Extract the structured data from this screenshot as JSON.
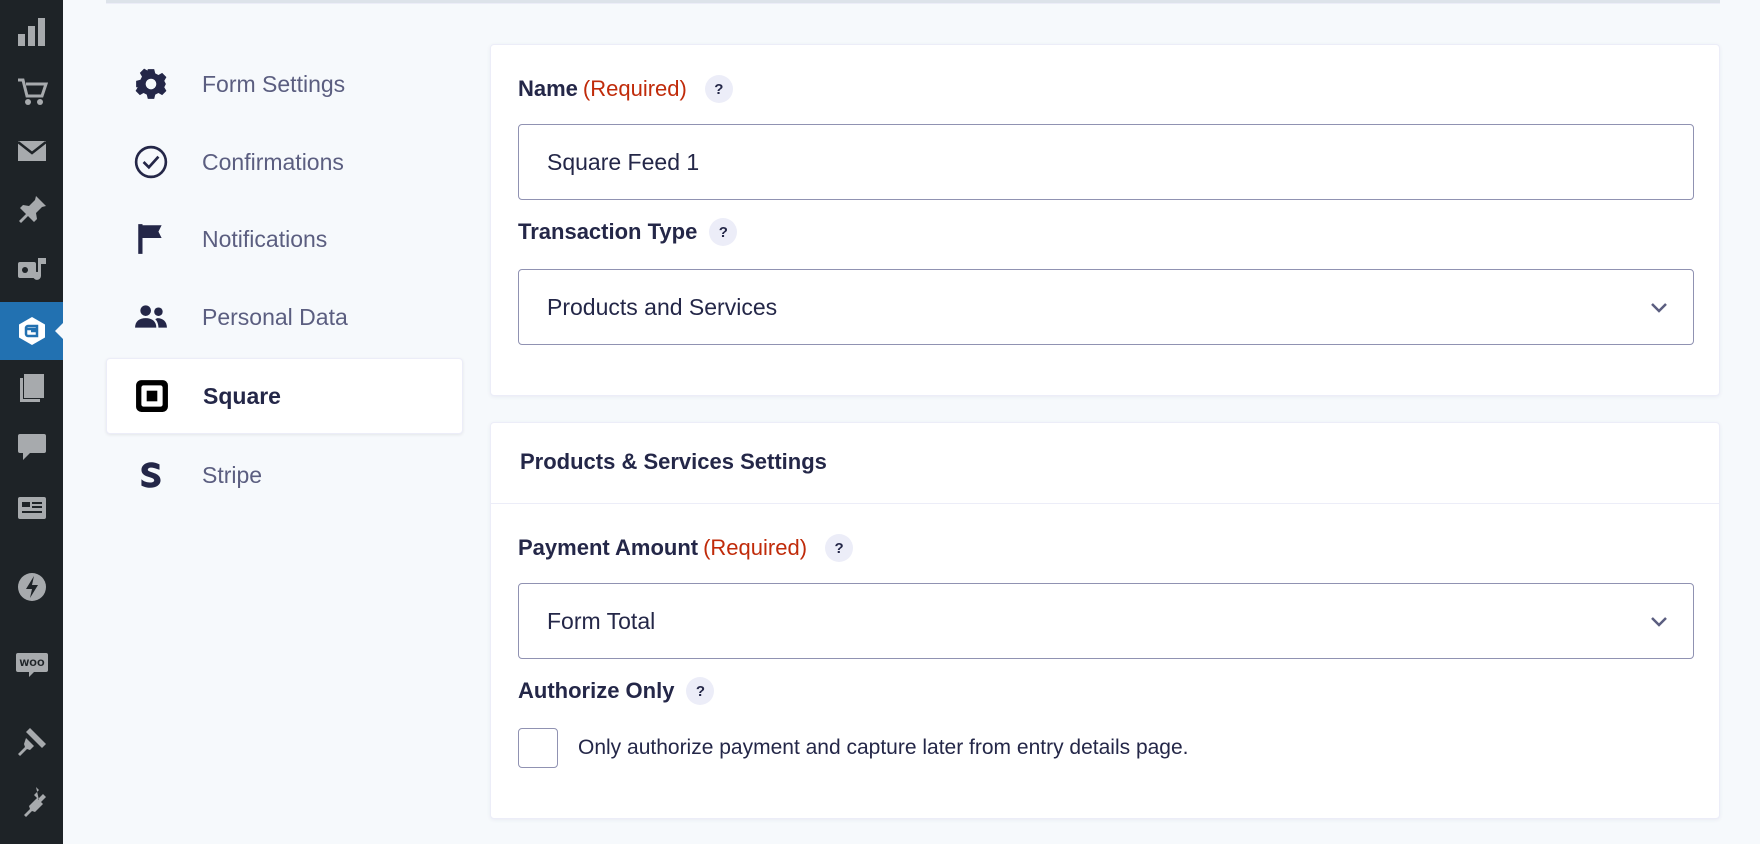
{
  "admin_sidebar": {
    "icons": [
      "dashboard-chart-icon",
      "cart-icon",
      "mail-icon",
      "pin-icon",
      "media-icon",
      "gravity-forms-icon",
      "pages-icon",
      "comments-icon",
      "forms-list-icon",
      "bolt-icon",
      "woo-icon",
      "appearance-icon",
      "plugins-icon"
    ],
    "woo_text": "WOO"
  },
  "settings_nav": {
    "items": [
      {
        "label": "Form Settings",
        "icon": "gear-icon"
      },
      {
        "label": "Confirmations",
        "icon": "check-circle-icon"
      },
      {
        "label": "Notifications",
        "icon": "flag-icon"
      },
      {
        "label": "Personal Data",
        "icon": "people-icon"
      },
      {
        "label": "Square",
        "icon": "square-logo-icon",
        "active": true
      },
      {
        "label": "Stripe",
        "icon": "stripe-logo-icon"
      }
    ]
  },
  "feed_panel": {
    "name_label": "Name",
    "name_required": "(Required)",
    "name_value": "Square Feed 1",
    "transaction_label": "Transaction Type",
    "transaction_value": "Products and Services",
    "help": "?"
  },
  "products_panel": {
    "title": "Products & Services Settings",
    "amount_label": "Payment Amount",
    "amount_required": "(Required)",
    "amount_value": "Form Total",
    "authorize_label": "Authorize Only",
    "authorize_text": "Only authorize payment and capture later from entry details page.",
    "help": "?"
  },
  "colors": {
    "sidebar_bg": "#1e2327",
    "active_blue": "#2271b1",
    "required_red": "#c02b0a",
    "text_dark": "#242748"
  }
}
